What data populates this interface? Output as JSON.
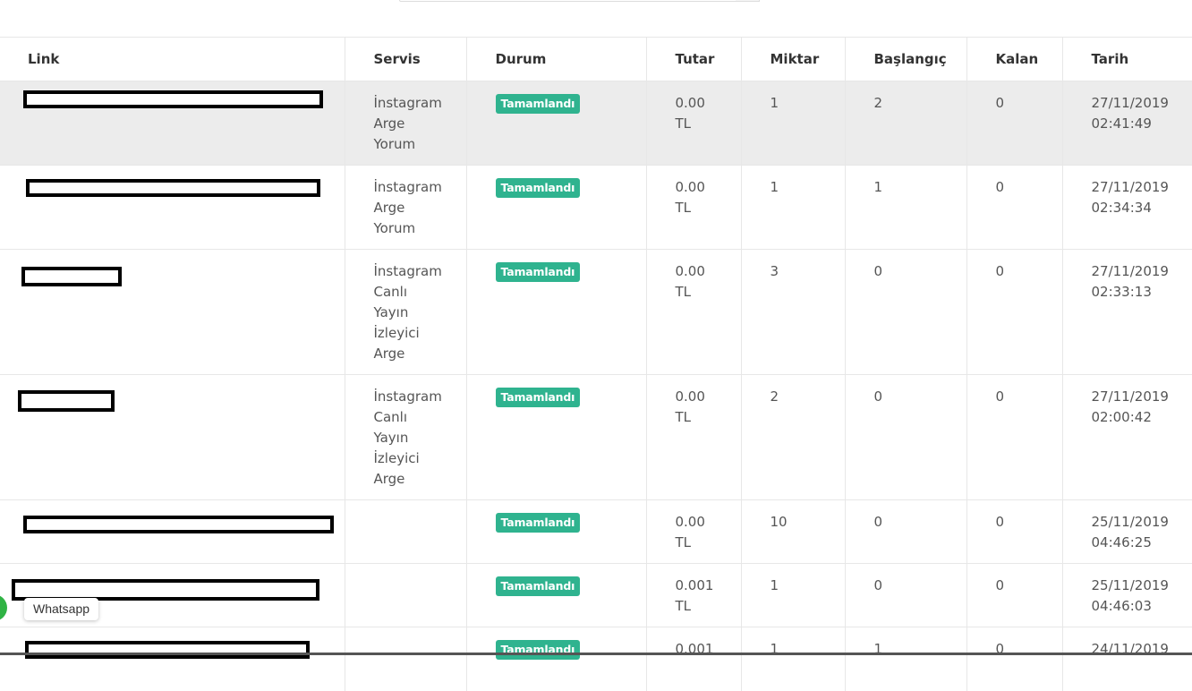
{
  "table": {
    "headers": [
      "Link",
      "Servis",
      "Durum",
      "Tutar",
      "Miktar",
      "Başlangıç",
      "Kalan",
      "Tarih"
    ],
    "rows": [
      {
        "servis": [
          "İnstagram",
          "Arge",
          "Yorum"
        ],
        "durum": "Tamamlandı",
        "tutar": [
          "0.00",
          "TL"
        ],
        "miktar": "1",
        "baslangic": "2",
        "kalan": "0",
        "tarih": [
          "27/11/2019",
          "02:41:49"
        ]
      },
      {
        "servis": [
          "İnstagram",
          "Arge",
          "Yorum"
        ],
        "durum": "Tamamlandı",
        "tutar": [
          "0.00",
          "TL"
        ],
        "miktar": "1",
        "baslangic": "1",
        "kalan": "0",
        "tarih": [
          "27/11/2019",
          "02:34:34"
        ]
      },
      {
        "servis": [
          "İnstagram",
          "Canlı",
          "Yayın",
          "İzleyici",
          "Arge"
        ],
        "durum": "Tamamlandı",
        "tutar": [
          "0.00",
          "TL"
        ],
        "miktar": "3",
        "baslangic": "0",
        "kalan": "0",
        "tarih": [
          "27/11/2019",
          "02:33:13"
        ]
      },
      {
        "servis": [
          "İnstagram",
          "Canlı",
          "Yayın",
          "İzleyici",
          "Arge"
        ],
        "durum": "Tamamlandı",
        "tutar": [
          "0.00",
          "TL"
        ],
        "miktar": "2",
        "baslangic": "0",
        "kalan": "0",
        "tarih": [
          "27/11/2019",
          "02:00:42"
        ]
      },
      {
        "servis": [],
        "durum": "Tamamlandı",
        "tutar": [
          "0.00",
          "TL"
        ],
        "miktar": "10",
        "baslangic": "0",
        "kalan": "0",
        "tarih": [
          "25/11/2019",
          "04:46:25"
        ]
      },
      {
        "servis": [],
        "durum": "Tamamlandı",
        "tutar": [
          "0.001",
          "TL"
        ],
        "miktar": "1",
        "baslangic": "0",
        "kalan": "0",
        "tarih": [
          "25/11/2019",
          "04:46:03"
        ]
      },
      {
        "servis": [],
        "durum": "Tamamlandı",
        "tutar": [
          "0.001",
          ""
        ],
        "miktar": "1",
        "baslangic": "1",
        "kalan": "0",
        "tarih": [
          "24/11/2019",
          ""
        ]
      }
    ]
  },
  "whatsapp": {
    "label": "Whatsapp",
    "color": "#2fb344"
  },
  "colors": {
    "badge": "#2fb38f",
    "highlight_row": "#ececec"
  }
}
